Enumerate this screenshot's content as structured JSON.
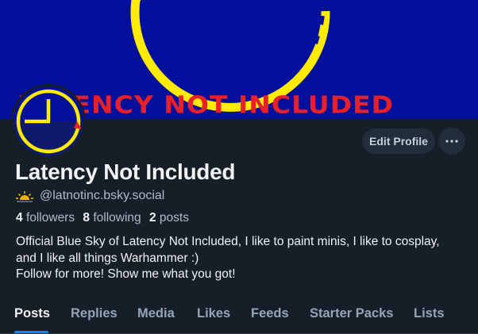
{
  "banner": {
    "text": "LATENCY NOT INCLUDED",
    "background": "#02109c",
    "text_color": "#e8202a",
    "ring_color": "#ffec00"
  },
  "profile": {
    "display_name": "Latency Not Included",
    "handle": "@latnotinc.bsky.social",
    "handle_icon": "sun-weather-icon",
    "edit_label": "Edit Profile",
    "more_icon": "ellipsis-icon",
    "followers_count": "4",
    "followers_label": "followers",
    "following_count": "8",
    "following_label": "following",
    "posts_count": "2",
    "posts_label": "posts",
    "bio_lines": [
      "Official Blue Sky of Latency Not Included, I like to paint minis, I like to cosplay,",
      "and I like all things Warhammer :)",
      "Follow for more! Show me what you got!"
    ]
  },
  "tabs": [
    "Posts",
    "Replies",
    "Media",
    "Likes",
    "Feeds",
    "Starter Packs",
    "Lists"
  ],
  "active_tab": "Posts",
  "colors": {
    "background": "#161e27",
    "accent": "#1083fe",
    "muted": "#aebbc9"
  }
}
